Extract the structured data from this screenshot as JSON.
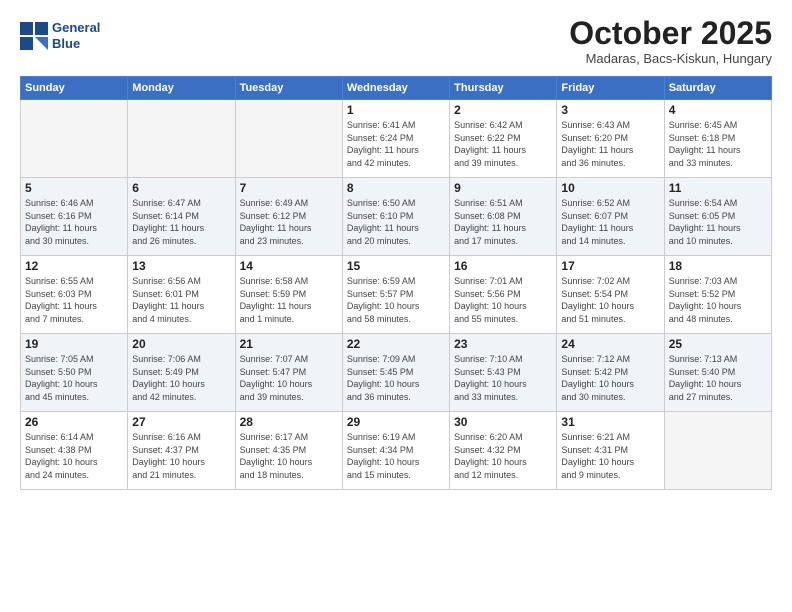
{
  "header": {
    "logo_line1": "General",
    "logo_line2": "Blue",
    "month": "October 2025",
    "location": "Madaras, Bacs-Kiskun, Hungary"
  },
  "weekdays": [
    "Sunday",
    "Monday",
    "Tuesday",
    "Wednesday",
    "Thursday",
    "Friday",
    "Saturday"
  ],
  "weeks": [
    [
      {
        "day": "",
        "info": ""
      },
      {
        "day": "",
        "info": ""
      },
      {
        "day": "",
        "info": ""
      },
      {
        "day": "1",
        "info": "Sunrise: 6:41 AM\nSunset: 6:24 PM\nDaylight: 11 hours\nand 42 minutes."
      },
      {
        "day": "2",
        "info": "Sunrise: 6:42 AM\nSunset: 6:22 PM\nDaylight: 11 hours\nand 39 minutes."
      },
      {
        "day": "3",
        "info": "Sunrise: 6:43 AM\nSunset: 6:20 PM\nDaylight: 11 hours\nand 36 minutes."
      },
      {
        "day": "4",
        "info": "Sunrise: 6:45 AM\nSunset: 6:18 PM\nDaylight: 11 hours\nand 33 minutes."
      }
    ],
    [
      {
        "day": "5",
        "info": "Sunrise: 6:46 AM\nSunset: 6:16 PM\nDaylight: 11 hours\nand 30 minutes."
      },
      {
        "day": "6",
        "info": "Sunrise: 6:47 AM\nSunset: 6:14 PM\nDaylight: 11 hours\nand 26 minutes."
      },
      {
        "day": "7",
        "info": "Sunrise: 6:49 AM\nSunset: 6:12 PM\nDaylight: 11 hours\nand 23 minutes."
      },
      {
        "day": "8",
        "info": "Sunrise: 6:50 AM\nSunset: 6:10 PM\nDaylight: 11 hours\nand 20 minutes."
      },
      {
        "day": "9",
        "info": "Sunrise: 6:51 AM\nSunset: 6:08 PM\nDaylight: 11 hours\nand 17 minutes."
      },
      {
        "day": "10",
        "info": "Sunrise: 6:52 AM\nSunset: 6:07 PM\nDaylight: 11 hours\nand 14 minutes."
      },
      {
        "day": "11",
        "info": "Sunrise: 6:54 AM\nSunset: 6:05 PM\nDaylight: 11 hours\nand 10 minutes."
      }
    ],
    [
      {
        "day": "12",
        "info": "Sunrise: 6:55 AM\nSunset: 6:03 PM\nDaylight: 11 hours\nand 7 minutes."
      },
      {
        "day": "13",
        "info": "Sunrise: 6:56 AM\nSunset: 6:01 PM\nDaylight: 11 hours\nand 4 minutes."
      },
      {
        "day": "14",
        "info": "Sunrise: 6:58 AM\nSunset: 5:59 PM\nDaylight: 11 hours\nand 1 minute."
      },
      {
        "day": "15",
        "info": "Sunrise: 6:59 AM\nSunset: 5:57 PM\nDaylight: 10 hours\nand 58 minutes."
      },
      {
        "day": "16",
        "info": "Sunrise: 7:01 AM\nSunset: 5:56 PM\nDaylight: 10 hours\nand 55 minutes."
      },
      {
        "day": "17",
        "info": "Sunrise: 7:02 AM\nSunset: 5:54 PM\nDaylight: 10 hours\nand 51 minutes."
      },
      {
        "day": "18",
        "info": "Sunrise: 7:03 AM\nSunset: 5:52 PM\nDaylight: 10 hours\nand 48 minutes."
      }
    ],
    [
      {
        "day": "19",
        "info": "Sunrise: 7:05 AM\nSunset: 5:50 PM\nDaylight: 10 hours\nand 45 minutes."
      },
      {
        "day": "20",
        "info": "Sunrise: 7:06 AM\nSunset: 5:49 PM\nDaylight: 10 hours\nand 42 minutes."
      },
      {
        "day": "21",
        "info": "Sunrise: 7:07 AM\nSunset: 5:47 PM\nDaylight: 10 hours\nand 39 minutes."
      },
      {
        "day": "22",
        "info": "Sunrise: 7:09 AM\nSunset: 5:45 PM\nDaylight: 10 hours\nand 36 minutes."
      },
      {
        "day": "23",
        "info": "Sunrise: 7:10 AM\nSunset: 5:43 PM\nDaylight: 10 hours\nand 33 minutes."
      },
      {
        "day": "24",
        "info": "Sunrise: 7:12 AM\nSunset: 5:42 PM\nDaylight: 10 hours\nand 30 minutes."
      },
      {
        "day": "25",
        "info": "Sunrise: 7:13 AM\nSunset: 5:40 PM\nDaylight: 10 hours\nand 27 minutes."
      }
    ],
    [
      {
        "day": "26",
        "info": "Sunrise: 6:14 AM\nSunset: 4:38 PM\nDaylight: 10 hours\nand 24 minutes."
      },
      {
        "day": "27",
        "info": "Sunrise: 6:16 AM\nSunset: 4:37 PM\nDaylight: 10 hours\nand 21 minutes."
      },
      {
        "day": "28",
        "info": "Sunrise: 6:17 AM\nSunset: 4:35 PM\nDaylight: 10 hours\nand 18 minutes."
      },
      {
        "day": "29",
        "info": "Sunrise: 6:19 AM\nSunset: 4:34 PM\nDaylight: 10 hours\nand 15 minutes."
      },
      {
        "day": "30",
        "info": "Sunrise: 6:20 AM\nSunset: 4:32 PM\nDaylight: 10 hours\nand 12 minutes."
      },
      {
        "day": "31",
        "info": "Sunrise: 6:21 AM\nSunset: 4:31 PM\nDaylight: 10 hours\nand 9 minutes."
      },
      {
        "day": "",
        "info": ""
      }
    ]
  ]
}
